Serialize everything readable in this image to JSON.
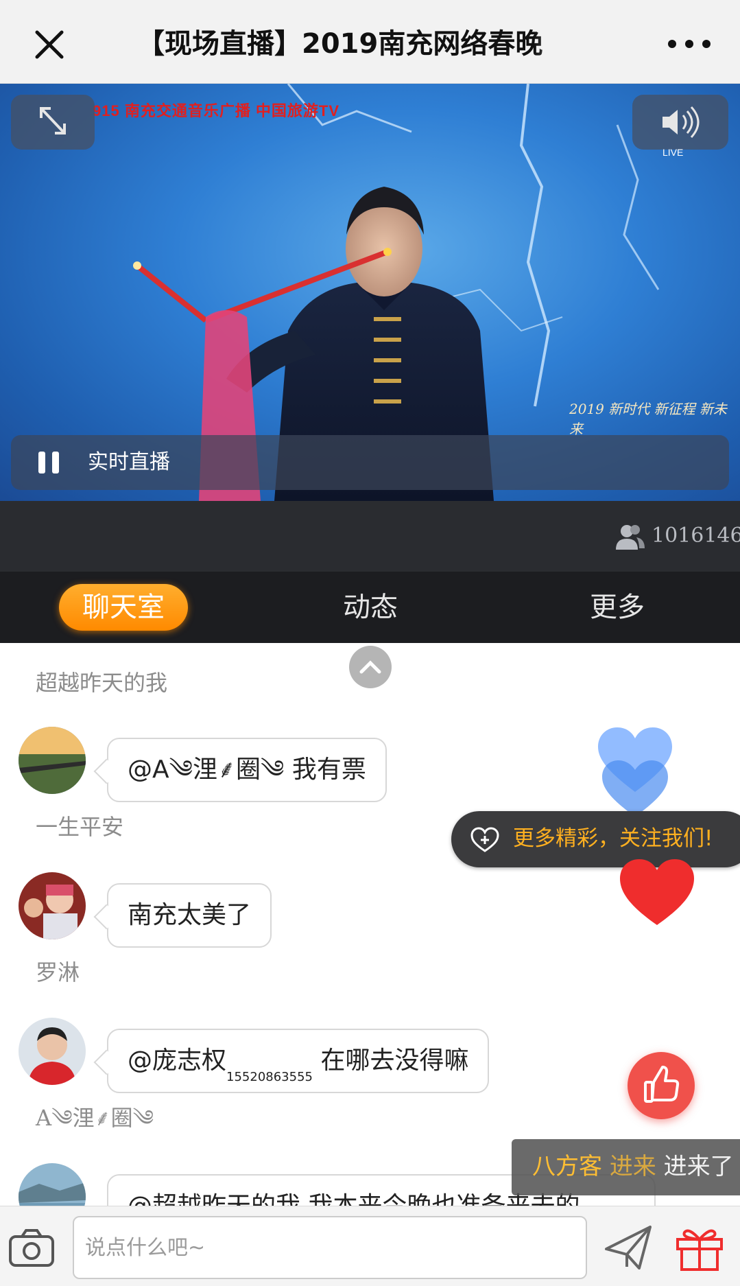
{
  "nav": {
    "title": "【现场直播】2019南充网络春晚"
  },
  "video": {
    "brand_text": "915 南充交通音乐广播  中国旅游TV",
    "live_tag": "LIVE",
    "event_logo": "2019 新时代 新征程 新未来",
    "status_label": "实时直播"
  },
  "stats": {
    "viewer_count": "1016146"
  },
  "tabs": [
    {
      "label": "聊天室",
      "active": true
    },
    {
      "label": "动态",
      "active": false
    },
    {
      "label": "更多",
      "active": false
    }
  ],
  "messages": [
    {
      "name": "超越昨天的我",
      "text": "@A༄浬⸙圈༄ 我有票"
    },
    {
      "name": "一生平安",
      "text": "南充太美了"
    },
    {
      "name": "罗淋",
      "text_prefix": "@庞志权",
      "text_sub": "15520863555",
      "text_suffix": " 在哪去没得嘛"
    },
    {
      "name": "A༄浬⸙圈༄",
      "text": "@超越昨天的我 我本来今晚也准备来去的"
    }
  ],
  "follow_toast": {
    "text": "更多精彩，关注我们!"
  },
  "enter_toast": {
    "name1": "八方客",
    "name2": "进来",
    "suffix": "进来了"
  },
  "input": {
    "placeholder": "说点什么吧~"
  },
  "colors": {
    "accent": "#ff9a14",
    "like": "#f0514b",
    "dark_bg": "#1c1d20"
  }
}
